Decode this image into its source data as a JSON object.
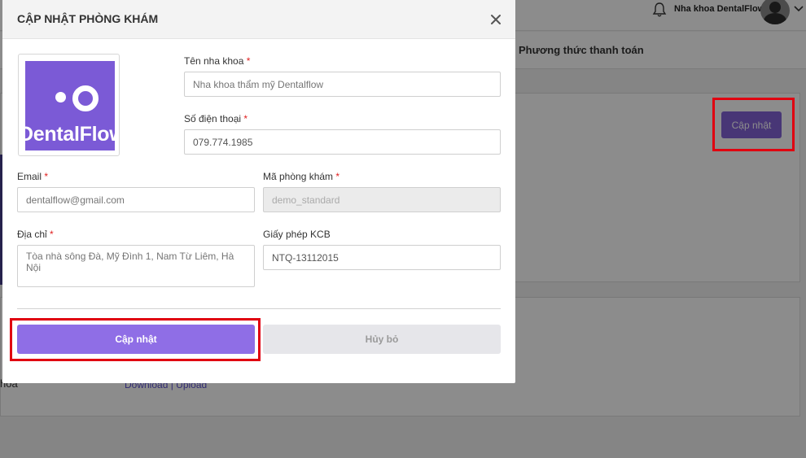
{
  "header": {
    "clinic_name": "Nha khoa DentalFlow"
  },
  "background": {
    "tab_label": "Phương thức thanh toán",
    "update_button": "Cập nhật",
    "links": "Download | Upload",
    "left_text": "hóa"
  },
  "modal": {
    "title": "CẬP NHẬT PHÒNG KHÁM",
    "logo_text": "DentalFlow",
    "required_mark": "*",
    "fields": {
      "clinic_name": {
        "label": "Tên nha khoa",
        "placeholder": "Nha khoa thẩm mỹ Dentalflow"
      },
      "phone": {
        "label": "Số điện thoại",
        "value": "079.774.1985"
      },
      "email": {
        "label": "Email",
        "placeholder": "dentalflow@gmail.com"
      },
      "clinic_code": {
        "label": "Mã phòng khám",
        "value": "demo_standard"
      },
      "address": {
        "label": "Địa chỉ",
        "placeholder": "Tòa nhà sông Đà, Mỹ Đình 1, Nam Từ Liêm, Hà Nội"
      },
      "license": {
        "label": "Giấy phép KCB",
        "value": "NTQ-13112015"
      }
    },
    "buttons": {
      "update": "Cập nhật",
      "cancel": "Hủy bỏ"
    }
  },
  "colors": {
    "accent": "#8f6ee6",
    "highlight": "#e00010"
  }
}
